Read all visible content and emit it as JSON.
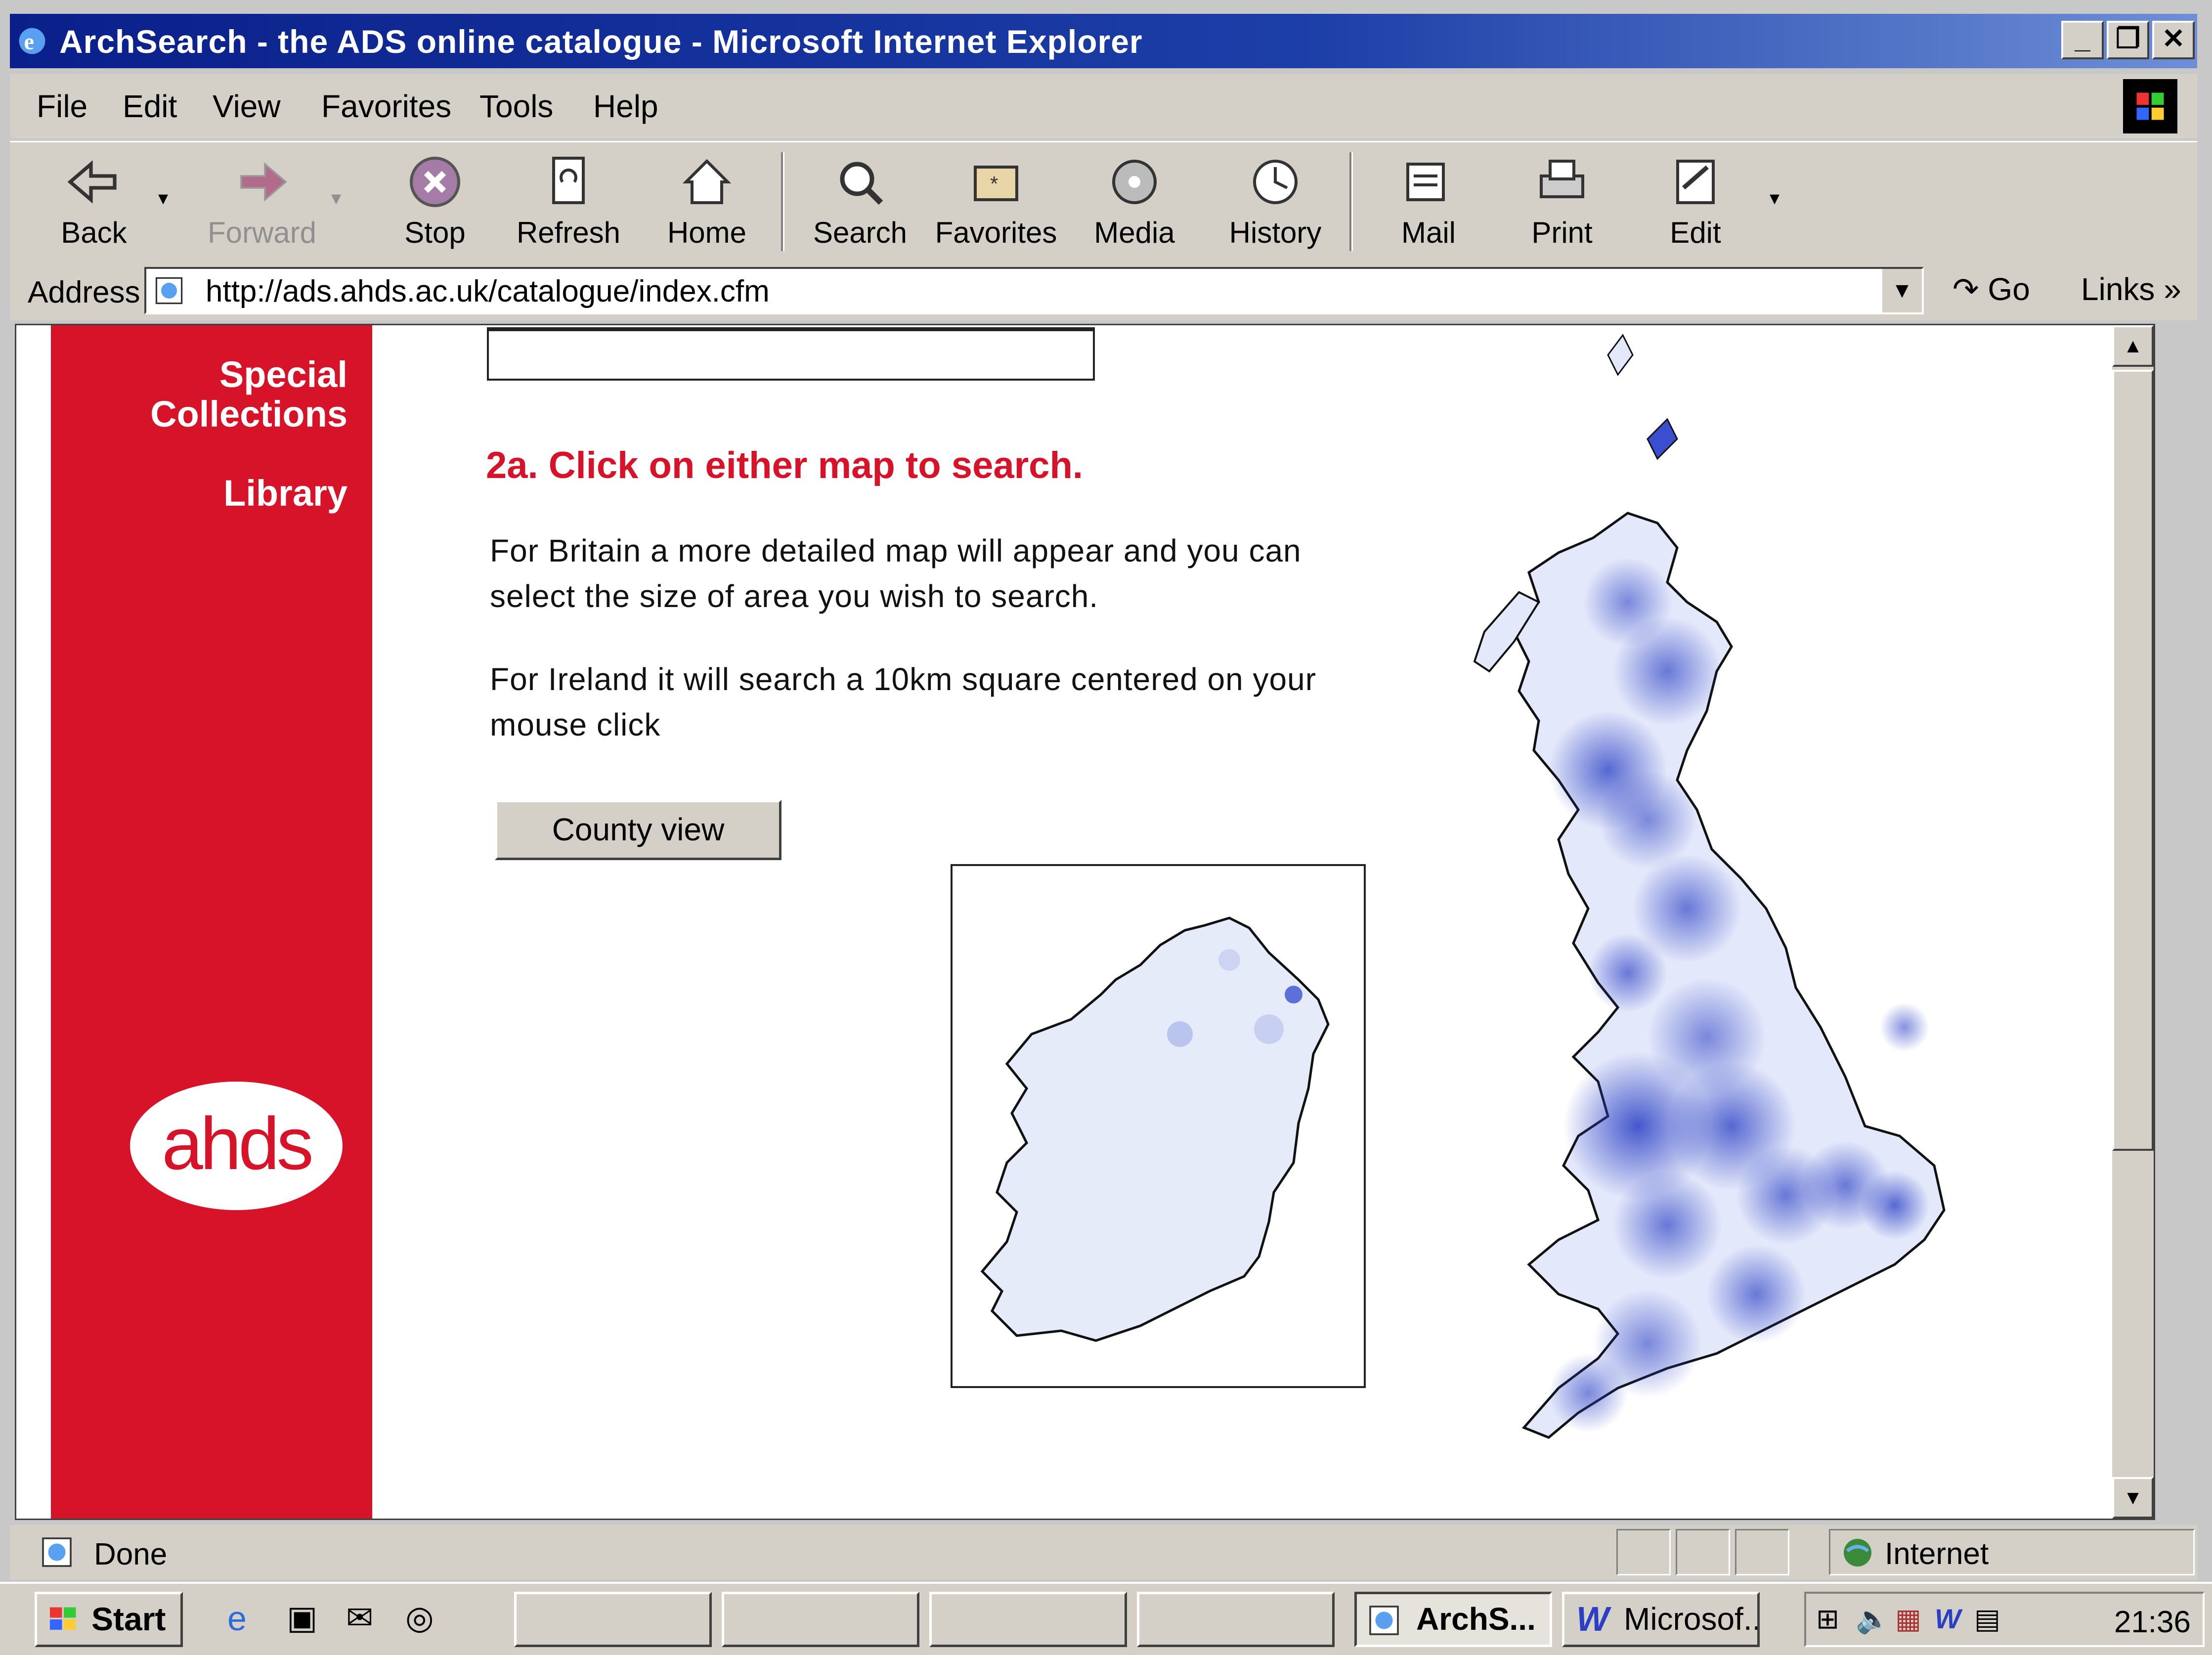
{
  "window": {
    "title": "ArchSearch - the ADS online catalogue - Microsoft Internet Explorer",
    "controls": [
      "_",
      "❐",
      "✕"
    ]
  },
  "menu": [
    "File",
    "Edit",
    "View",
    "Favorites",
    "Tools",
    "Help"
  ],
  "toolbar": {
    "back": "Back",
    "forward": "Forward",
    "stop": "Stop",
    "refresh": "Refresh",
    "home": "Home",
    "search": "Search",
    "favorites": "Favorites",
    "media": "Media",
    "history": "History",
    "mail": "Mail",
    "print": "Print",
    "edit": "Edit"
  },
  "address": {
    "label": "Address",
    "url": "http://ads.ahds.ac.uk/catalogue/index.cfm",
    "go": "Go",
    "links": "Links"
  },
  "sidebar": {
    "special_collections": "Special Collections",
    "library": "Library",
    "logo": "ahds"
  },
  "main": {
    "heading": "2a. Click on either map to search.",
    "britain_text": "For Britain a more detailed map will appear and you can select the size of area you wish to search.",
    "ireland_text": "For Ireland it will search a 10km square centered on your mouse click",
    "county_button": "County view"
  },
  "status": {
    "text": "Done",
    "zone": "Internet"
  },
  "taskbar": {
    "start": "Start",
    "tasks": [
      "ArchS...",
      "Microsof..."
    ],
    "clock": "21:36"
  },
  "colors": {
    "brand_red": "#d7132a",
    "map_blue": "#3a4fd0",
    "title_bar": "#0a1f8a"
  }
}
